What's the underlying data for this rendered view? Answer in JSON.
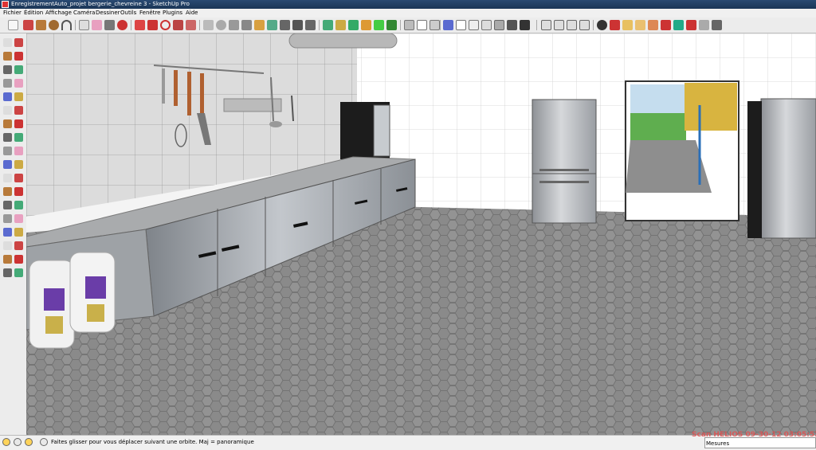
{
  "window": {
    "title": "EnregistrementAuto_projet bergerie_chevreine 3 - SketchUp Pro"
  },
  "menu": [
    "Fichier",
    "Édition",
    "Affichage",
    "Caméra",
    "Dessiner",
    "Outils",
    "Fenêtre",
    "Plugins",
    "Aide"
  ],
  "status": {
    "message": "Faites glisser pour vous déplacer suivant une orbite.  Maj = panoramique",
    "measure_label": "Mesures"
  },
  "watermark": "Scan HELIOS 09-30-12 03:05:52",
  "colors": {
    "titlebar": "#1f3c62",
    "floor": "#8a8a8a",
    "wall_tiles": "#d9d9d9",
    "cabinet": "#a9adb2",
    "watermark": "#e05050"
  },
  "icons": {
    "toolbar": [
      "select-icon",
      "pencil-icon",
      "rectangle-icon",
      "circle-icon",
      "arc-icon",
      "eraser-icon",
      "paint-bucket-icon",
      "tape-measure-icon",
      "push-pull-icon",
      "move-icon",
      "rotate-icon",
      "follow-me-icon",
      "offset-icon",
      "orbit-icon",
      "pan-icon",
      "zoom-icon",
      "zoom-extents-icon",
      "home-icon",
      "3d-text-icon",
      "section-icon",
      "views-icon",
      "styles-icon",
      "components-icon",
      "layers-icon"
    ],
    "left_toolbar": [
      "select-icon",
      "make-component-icon",
      "paint-icon",
      "eraser-icon",
      "rectangle-icon",
      "line-icon",
      "circle-icon",
      "arc-icon",
      "polygon-icon",
      "freehand-icon",
      "move-icon",
      "push-pull-icon",
      "rotate-icon",
      "follow-me-icon",
      "scale-icon",
      "offset-icon",
      "tape-icon",
      "dimension-icon",
      "protractor-icon",
      "text-icon",
      "axes-icon",
      "3d-text-icon",
      "orbit-icon",
      "pan-icon",
      "zoom-icon",
      "zoom-window-icon",
      "zoom-extents-icon",
      "previous-icon",
      "position-camera-icon",
      "walk-icon",
      "look-around-icon",
      "section-plane-icon",
      "sandbox-icon",
      "stamp-icon",
      "drape-icon",
      "smoove-icon"
    ]
  }
}
